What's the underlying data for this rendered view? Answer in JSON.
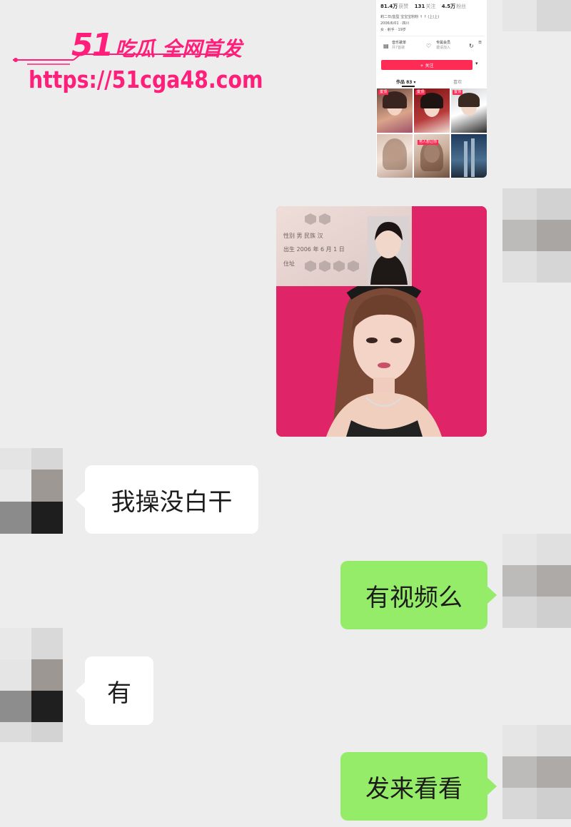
{
  "watermark": {
    "brand_number": "51",
    "brand_text": "吃瓜 全网首发",
    "url": "https://51cga48.com"
  },
  "profile_card": {
    "stats": [
      {
        "value": "81.4万",
        "label": "获赞"
      },
      {
        "value": "131",
        "label": "关注"
      },
      {
        "value": "4.5万",
        "label": "粉丝"
      }
    ],
    "bio_line1": "莉二日/血型 宝宝宝粉粉 ↑ ↑ (上(上)",
    "bio_line2": "2006/6/01 · 四川",
    "bio_line3": "女 · 射手 · 19岁",
    "quick_items": [
      {
        "title": "音乐歌单",
        "sub": "共7首歌"
      },
      {
        "title": "专属会员",
        "sub": "邀请加入"
      },
      {
        "title": "日",
        "sub": ""
      }
    ],
    "follow_label": "+ 关注",
    "tab_works": "作品 83 ▾",
    "tab_likes": "喜欢",
    "thumb_tags": [
      "置顶",
      "置顶",
      "置顶",
      "",
      "",
      "",
      "男人想让你",
      ""
    ]
  },
  "photo_card": {
    "id_text_gender": "性别 男  民族 汉",
    "id_text_birth": "出生 2006 年 6 月 1 日",
    "id_text_addr": "住址"
  },
  "messages": [
    {
      "side": "left",
      "text": "我操没白干"
    },
    {
      "side": "right",
      "text": "有视频么"
    },
    {
      "side": "left",
      "text": "有"
    },
    {
      "side": "right",
      "text": "发来看看"
    }
  ],
  "colors": {
    "background": "#ededed",
    "sent_bubble": "#95ec69",
    "received_bubble": "#ffffff",
    "watermark": "#ff1f7a",
    "photo_bg": "#e0206a"
  }
}
